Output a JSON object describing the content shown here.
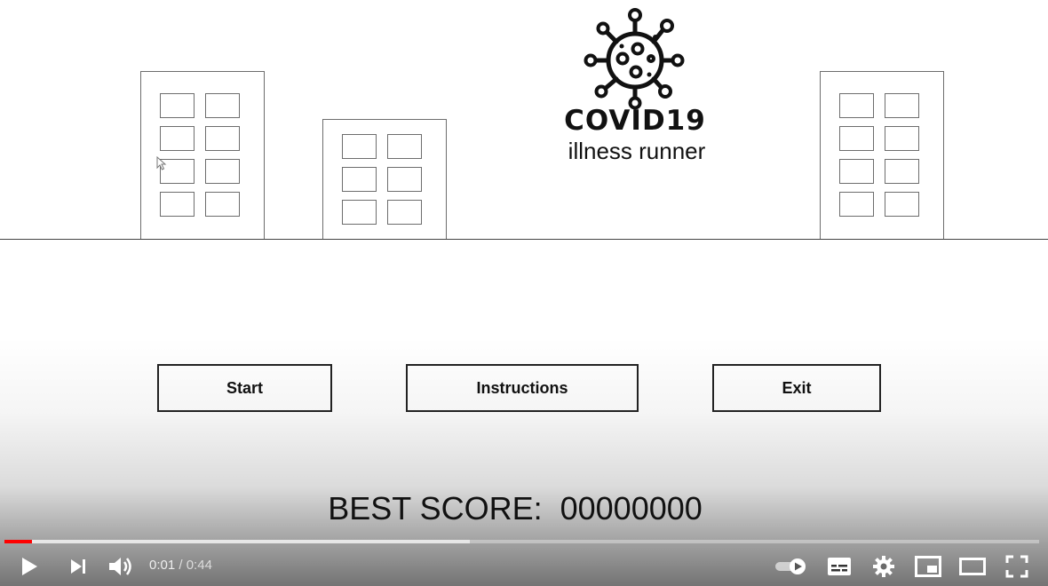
{
  "game": {
    "title": "COVID19",
    "subtitle": "illness runner",
    "buttons": {
      "start": "Start",
      "instructions": "Instructions",
      "exit": "Exit"
    },
    "best_score_label": "BEST SCORE:  ",
    "best_score_value": "00000000"
  },
  "player": {
    "current_time": "0:01",
    "separator": " / ",
    "duration": "0:44",
    "played_fraction": 0.027,
    "loaded_fraction": 0.45,
    "colors": {
      "progress_played": "#ff0000",
      "controls": "#ffffff"
    },
    "icons": [
      "play-icon",
      "next-icon",
      "volume-icon",
      "autoplay-toggle-icon",
      "subtitles-icon",
      "settings-gear-icon",
      "miniplayer-icon",
      "theater-mode-icon",
      "fullscreen-icon"
    ]
  }
}
